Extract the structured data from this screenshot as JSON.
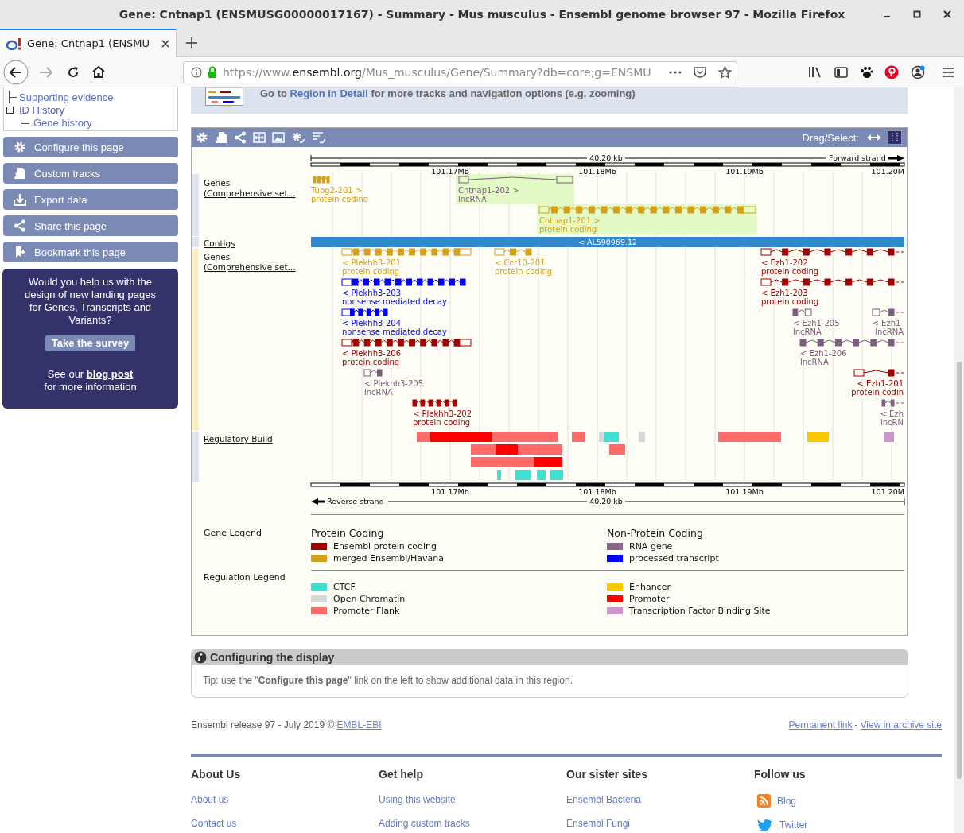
{
  "window": {
    "title": "Gene: Cntnap1 (ENSMUSG00000017167) - Summary - Mus musculus - Ensembl genome browser 97 - Mozilla Firefox"
  },
  "tabs": [
    {
      "label": "Gene: Cntnap1 (ENSMU",
      "selected": true
    }
  ],
  "address_bar": {
    "scheme": "https://www.",
    "domain": "ensembl.org",
    "path": "/Mus_musculus/Gene/Summary?db=core;g=ENSMU"
  },
  "sidebar": {
    "tree": [
      {
        "label": "Supporting evidence"
      },
      {
        "label": "ID History",
        "expanded": true,
        "children": [
          {
            "label": "Gene history"
          }
        ]
      }
    ],
    "actions": [
      "Configure this page",
      "Custom tracks",
      "Export data",
      "Share this page",
      "Bookmark this page"
    ],
    "survey": {
      "text": "Would you help us with the design of new landing pages for Genes, Transcripts and Variants?",
      "button": "Take the survey",
      "note_before": "See our",
      "note_link": "blog post",
      "note_after": "for more information"
    }
  },
  "region_banner": {
    "before": "Go to",
    "link": "Region in Detail",
    "after": "for more tracks and navigation options (e.g. zooming)"
  },
  "genome_browser": {
    "drag_select_label": "Drag/Select:",
    "scale_top": {
      "length": "40.20 kb",
      "strand": "Forward strand",
      "ticks": [
        "101.17Mb",
        "101.18Mb",
        "101.19Mb",
        "101.20M"
      ]
    },
    "scale_bottom": {
      "length": "40.20 kb",
      "strand": "Reverse strand",
      "ticks": [
        "101.17Mb",
        "101.18Mb",
        "101.19Mb",
        "101.20M"
      ]
    },
    "tracks": [
      {
        "label": "Genes (Comprehensive set..."
      },
      {
        "label": "Contigs"
      },
      {
        "label": "Genes (Comprehensive set..."
      },
      {
        "label": "Regulatory Build"
      }
    ],
    "forward_transcripts": [
      {
        "name": "Tubg2-201 >",
        "biotype": "protein coding",
        "color": "#d4a017",
        "highlighted": false
      },
      {
        "name": "Cntnap1-202 >",
        "biotype": "lncRNA",
        "color": "#7d5c7d",
        "highlighted": true
      },
      {
        "name": "Cntnap1-201 >",
        "biotype": "protein coding",
        "color": "#d4a017",
        "highlighted": true
      }
    ],
    "contig": {
      "name": "< AL590969.12"
    },
    "reverse_transcripts": [
      {
        "name": "< Plekhh3-201",
        "biotype": "protein coding",
        "color": "#d4a017"
      },
      {
        "name": "< Ccr10-201",
        "biotype": "protein coding",
        "color": "#d4a017"
      },
      {
        "name": "< Ezh1-202",
        "biotype": "protein coding",
        "color": "#a00000"
      },
      {
        "name": "< Plekhh3-203",
        "biotype": "nonsense mediated decay",
        "color": "#0000ff"
      },
      {
        "name": "< Ezh1-203",
        "biotype": "protein coding",
        "color": "#a00000"
      },
      {
        "name": "< Plekhh3-204",
        "biotype": "nonsense mediated decay",
        "color": "#0000ff"
      },
      {
        "name": "< Ezh1-205",
        "biotype": "lncRNA",
        "color": "#7d5c7d"
      },
      {
        "name": "< Ezh1-",
        "biotype": "lncRNA",
        "color": "#7d5c7d"
      },
      {
        "name": "< Plekhh3-206",
        "biotype": "protein coding",
        "color": "#a00000"
      },
      {
        "name": "< Ezh1-206",
        "biotype": "lncRNA",
        "color": "#7d5c7d"
      },
      {
        "name": "< Plekhh3-205",
        "biotype": "lncRNA",
        "color": "#7d5c7d"
      },
      {
        "name": "< Ezh1-201",
        "biotype": "protein codin",
        "color": "#a00000"
      },
      {
        "name": "< Plekhh3-202",
        "biotype": "protein coding",
        "color": "#a00000"
      },
      {
        "name": "< Ezh",
        "biotype": "lncRN",
        "color": "#7d5c7d"
      }
    ],
    "regulatory_features": [
      {
        "color": "#ff6a6a"
      },
      {
        "color": "#ff0000"
      },
      {
        "color": "#ff6a6a"
      },
      {
        "color": "#ff6a6a"
      },
      {
        "color": "#d8d8d8"
      },
      {
        "color": "#40e0d0"
      },
      {
        "color": "#d8d8d8"
      },
      {
        "color": "#ff6a6a"
      },
      {
        "color": "#fac800"
      },
      {
        "color": "#cd96cd"
      },
      {
        "color": "#ff6a6a"
      },
      {
        "color": "#ff0000"
      },
      {
        "color": "#ff6a6a"
      },
      {
        "color": "#ff6a6a"
      },
      {
        "color": "#ff6a6a"
      },
      {
        "color": "#ff0000"
      },
      {
        "color": "#40e0d0"
      },
      {
        "color": "#40e0d0"
      },
      {
        "color": "#40e0d0"
      },
      {
        "color": "#40e0d0"
      }
    ],
    "legends": [
      {
        "title": "Gene Legend",
        "groups": [
          {
            "title": "Protein Coding",
            "items": [
              {
                "label": "Ensembl protein coding",
                "color": "#a00000"
              },
              {
                "label": "merged Ensembl/Havana",
                "color": "#d4a017"
              }
            ]
          },
          {
            "title": "Non-Protein Coding",
            "items": [
              {
                "label": "RNA gene",
                "color": "#8b668b"
              },
              {
                "label": "processed transcript",
                "color": "#0000ff"
              }
            ]
          }
        ]
      },
      {
        "title": "Regulation Legend",
        "groups": [
          {
            "items": [
              {
                "label": "CTCF",
                "color": "#40e0d0"
              },
              {
                "label": "Open Chromatin",
                "color": "#d8d8d8"
              },
              {
                "label": "Promoter Flank",
                "color": "#ff6a6a"
              }
            ]
          },
          {
            "items": [
              {
                "label": "Enhancer",
                "color": "#fac800"
              },
              {
                "label": "Promoter",
                "color": "#ff0000"
              },
              {
                "label": "Transcription Factor Binding Site",
                "color": "#cd96cd"
              }
            ]
          }
        ]
      }
    ]
  },
  "configure_panel": {
    "title": "Configuring the display",
    "tip": "Tip: use the \"**Configure this page**\" link on the left to show additional data in this region."
  },
  "footer": {
    "release": "Ensembl release 97 - July 2019 ©",
    "release_link": "EMBL-EBI",
    "links": [
      "Permanent link",
      "View in archive site"
    ],
    "separator": "-",
    "columns": [
      {
        "title": "About Us",
        "kind": "links",
        "links": [
          "About us",
          "Contact us"
        ]
      },
      {
        "title": "Get help",
        "kind": "links",
        "links": [
          "Using this website",
          "Adding custom tracks"
        ]
      },
      {
        "title": "Our sister sites",
        "kind": "links",
        "links": [
          "Ensembl Bacteria",
          "Ensembl Fungi"
        ]
      },
      {
        "title": "Follow us",
        "kind": "social",
        "links": [
          "Blog",
          "Twitter"
        ]
      }
    ]
  }
}
